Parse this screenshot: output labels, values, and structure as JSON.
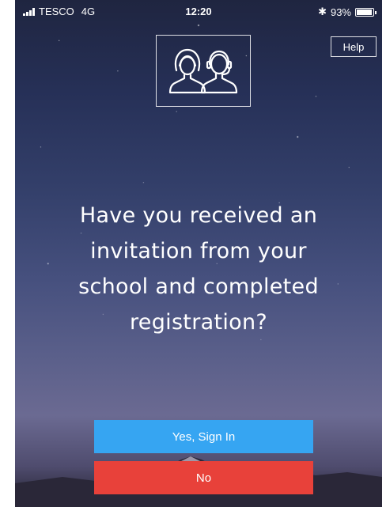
{
  "status_bar": {
    "carrier": "TESCO",
    "network": "4G",
    "time": "12:20",
    "bluetooth_symbol": "✱",
    "battery_percent": "93%",
    "battery_level": 0.93,
    "icons": [
      "signal-icon",
      "bluetooth-icon",
      "battery-icon"
    ]
  },
  "logo": {
    "icon": "two-people-icon"
  },
  "help": {
    "label": "Help"
  },
  "prompt": {
    "lines": [
      "Have you received an",
      "invitation from your",
      "school and completed",
      "registration?"
    ]
  },
  "actions": {
    "yes_label": "Yes, Sign In",
    "no_label": "No"
  },
  "colors": {
    "yes_button": "#36a5f2",
    "no_button": "#e8413a",
    "sky_top": "#1f2540",
    "sky_bottom": "#6b6a92"
  }
}
